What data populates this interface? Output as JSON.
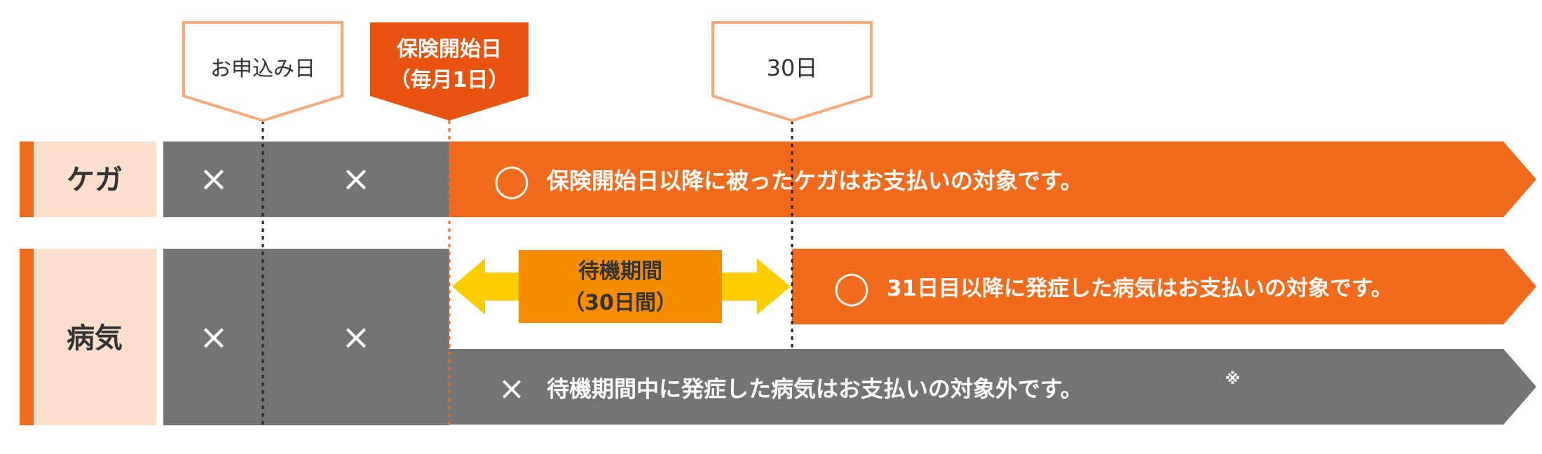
{
  "colors": {
    "orange": "#f26b1c",
    "orange_dark": "#e8530f",
    "gray": "#747474",
    "peach": "#fde0cc",
    "peach_border": "#f8a978",
    "yellow": "#fbcd00",
    "waiting_box": "#f68c00",
    "white": "#ffffff",
    "text_dark": "#333333"
  },
  "markers": {
    "application": {
      "label": "お申込み日"
    },
    "coverage_start": {
      "line1": "保険開始日",
      "line2": "（毎月1日）"
    },
    "day30": {
      "label": "30日"
    }
  },
  "rows": {
    "injury": {
      "label": "ケガ",
      "cell1_symbol": "×",
      "cell2_symbol": "×",
      "covered_symbol": "◯",
      "covered_text": "保険開始日以降に被ったケガはお支払いの対象です。"
    },
    "illness": {
      "label": "病気",
      "cell1_symbol": "×",
      "cell2_symbol": "×",
      "waiting_line1": "待機期間",
      "waiting_line2": "（30日間）",
      "covered_symbol": "◯",
      "covered_text": "31日目以降に発症した病気はお支払いの対象です。",
      "excluded_symbol": "×",
      "excluded_text": "待機期間中に発症した病気はお支払いの対象外です。",
      "excluded_note_mark": "※"
    }
  }
}
